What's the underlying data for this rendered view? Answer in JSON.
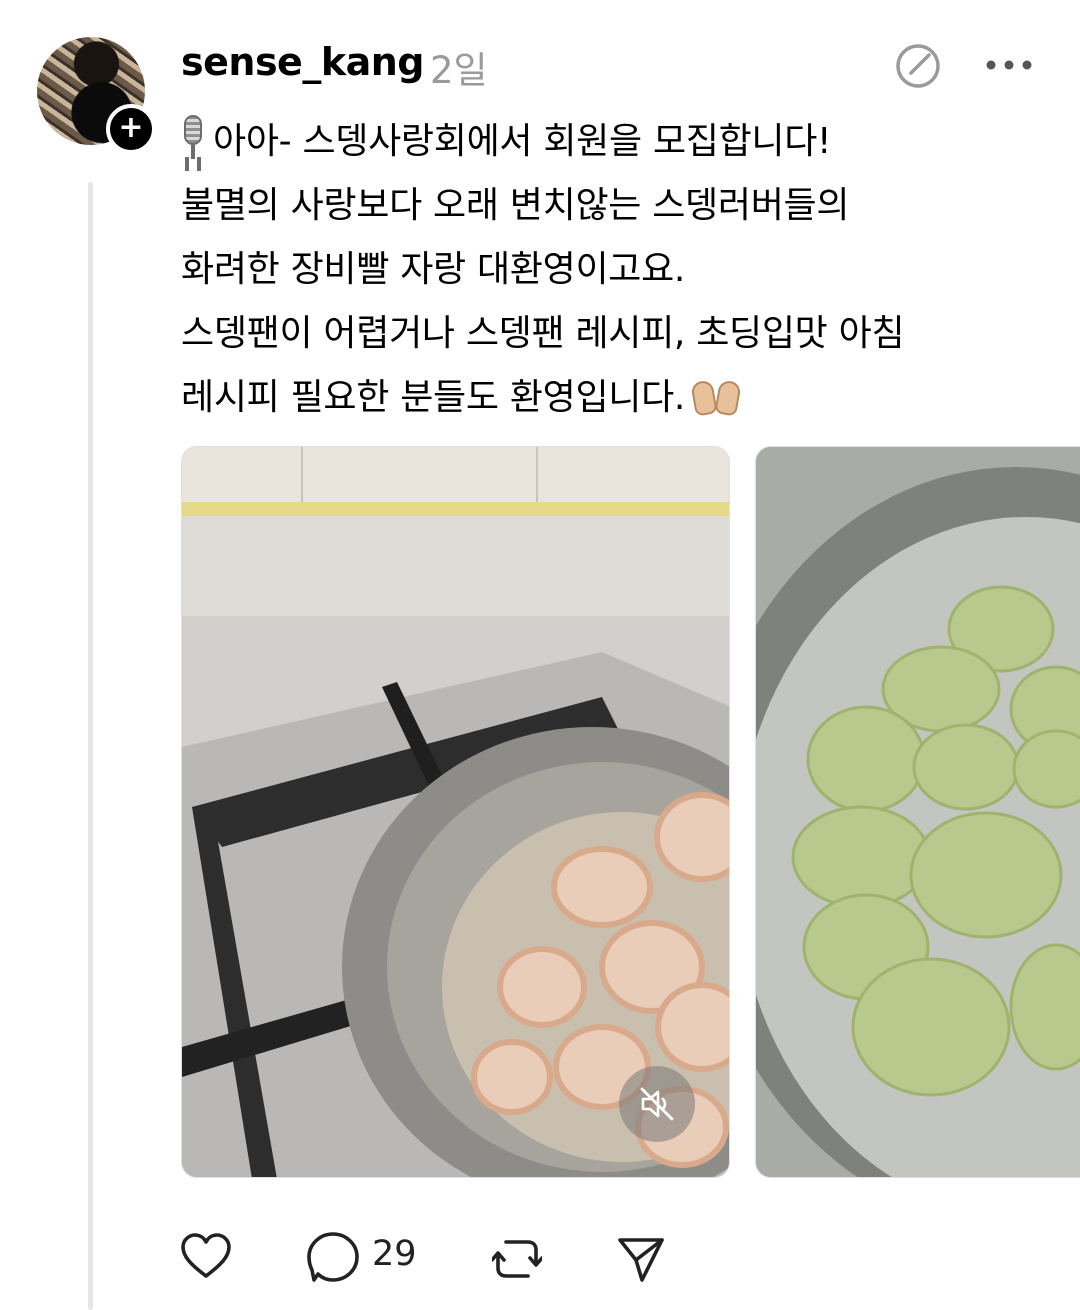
{
  "post": {
    "username": "sense_kang",
    "timestamp": "2일",
    "text_lines": [
      "아아- 스뎅사랑회에서 회원을 모집합니다!",
      "불멸의 사랑보다 오래 변치않는 스뎅러버들의",
      "화려한 장비빨 자랑 대환영이고요.",
      "스뎅팬이 어렵거나 스뎅팬 레시피, 초딩입맛 아침",
      "레시피 필요한 분들도 환영입니다."
    ],
    "leading_emoji": "microphone-emoji",
    "trailing_emoji": "raising-hands-emoji"
  },
  "media": [
    {
      "description_icon": "video-shrimp-in-pan",
      "muted": true
    },
    {
      "description_icon": "image-potato-slices-in-pan"
    }
  ],
  "actions": {
    "like_icon": "heart-icon",
    "reply_icon": "comment-icon",
    "reply_count": "29",
    "repost_icon": "repost-icon",
    "share_icon": "send-icon"
  },
  "colors": {
    "text": "#000000",
    "muted_text": "#9a9a9a",
    "thread_line": "#e6e6e6"
  }
}
